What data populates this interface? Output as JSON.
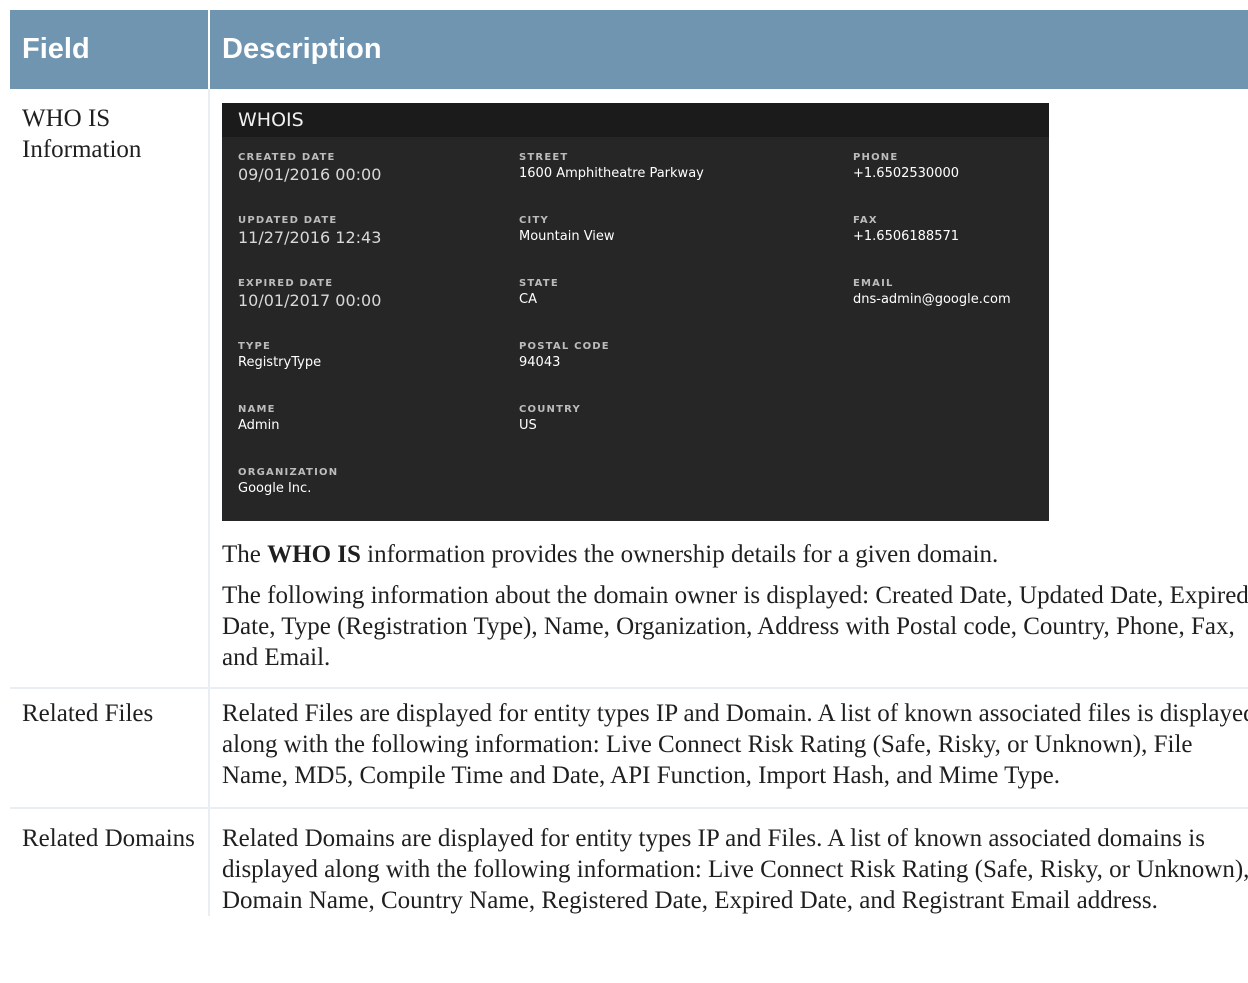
{
  "headers": {
    "field": "Field",
    "description": "Description"
  },
  "rows": {
    "whois": {
      "field": "WHO IS Information",
      "panel": {
        "title": "WHOIS",
        "col1": [
          {
            "label": "CREATED DATE",
            "value": "09/01/2016 00:00"
          },
          {
            "label": "UPDATED DATE",
            "value": "11/27/2016 12:43"
          },
          {
            "label": "EXPIRED DATE",
            "value": "10/01/2017 00:00"
          },
          {
            "label": "TYPE",
            "value": "RegistryType"
          },
          {
            "label": "NAME",
            "value": "Admin"
          },
          {
            "label": "ORGANIZATION",
            "value": "Google Inc."
          }
        ],
        "col2": [
          {
            "label": "STREET",
            "value": "1600 Amphitheatre Parkway"
          },
          {
            "label": "CITY",
            "value": "Mountain View"
          },
          {
            "label": "STATE",
            "value": "CA"
          },
          {
            "label": "POSTAL CODE",
            "value": "94043"
          },
          {
            "label": "COUNTRY",
            "value": "US"
          }
        ],
        "col3": [
          {
            "label": "PHONE",
            "value": "+1.6502530000"
          },
          {
            "label": "FAX",
            "value": "+1.6506188571"
          },
          {
            "label": "EMAIL",
            "value": "dns-admin@google.com"
          }
        ]
      },
      "p1_before": "The ",
      "p1_bold": "WHO IS",
      "p1_after": " information provides the ownership details for a given domain.",
      "p2": "The following information about the domain owner is displayed: Created Date, Updated Date, Expired Date, Type (Registration Type), Name, Organization, Address with Postal code, Country, Phone, Fax, and Email."
    },
    "related_files": {
      "field": "Related Files",
      "description": "Related Files are displayed for entity types IP and Domain. A list of known associated files is displayed along with the following information: Live Connect Risk Rating (Safe, Risky, or Unknown), File Name, MD5, Compile Time and Date, API Function, Import Hash, and Mime Type."
    },
    "related_domains": {
      "field": "Related Domains",
      "description": "Related Domains are displayed for entity types IP and Files. A list of known associated domains is displayed along with the following information: Live Connect Risk Rating (Safe, Risky, or Unknown), Domain Name, Country Name, Registered Date, Expired Date, and Registrant Email address."
    }
  }
}
